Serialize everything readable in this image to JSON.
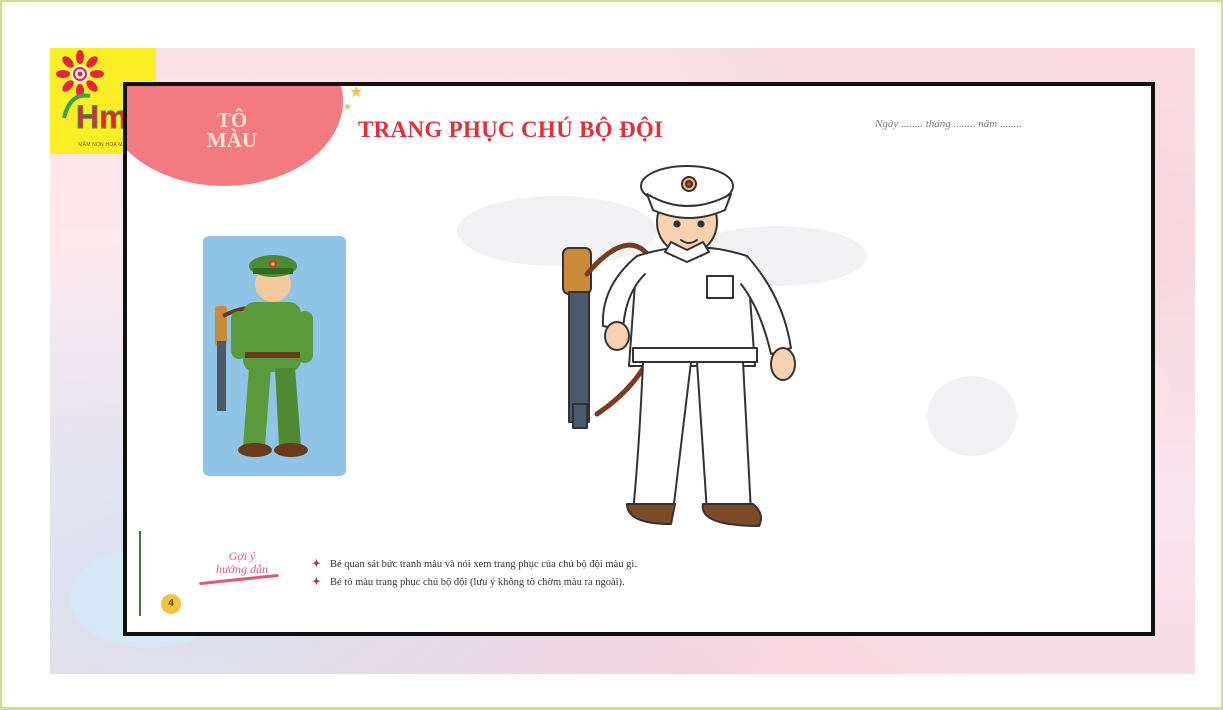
{
  "logo": {
    "text": "Hm",
    "caption": "MẦM NON HOA MAI"
  },
  "worksheet": {
    "section_label_line1": "TÔ",
    "section_label_line2": "MÀU",
    "title": "TRANG PHỤC CHÚ BỘ ĐỘI",
    "date_line": "Ngày ........ tháng ........ năm ........",
    "hint_label_line1": "Gợi ý",
    "hint_label_line2": "hướng dẫn",
    "bullet_symbol": "✦",
    "hints": [
      "Bé quan sát bức tranh màu và nói xem trang phục của chú bộ đội màu gì.",
      "Bé tô màu trang phục chú bộ đội (lưu ý không tô chờm màu ra ngoài)."
    ],
    "page_number": "4"
  },
  "colors": {
    "title_red": "#e0303a",
    "label_blob": "#f27a80",
    "reference_bg": "#8fc4e6",
    "uniform_green": "#5a9a3a",
    "logo_yellow": "#f9ef24",
    "frame_border": "#cfe08a"
  }
}
